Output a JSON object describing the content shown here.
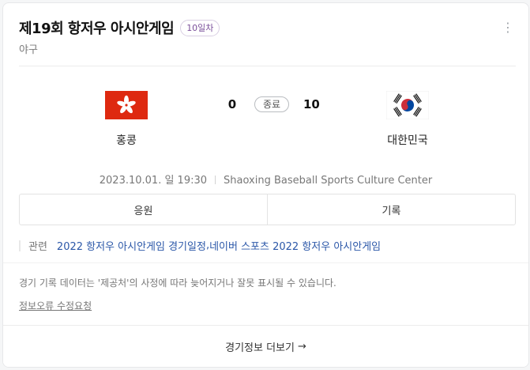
{
  "header": {
    "title": "제19회 항저우 아시안게임",
    "badge": "10일차",
    "subtitle": "야구",
    "more_icon": "⋮"
  },
  "match": {
    "home": {
      "name": "홍콩",
      "score": "0",
      "flag": "hong-kong-flag"
    },
    "away": {
      "name": "대한민국",
      "score": "10",
      "flag": "south-korea-flag"
    },
    "status": "종료",
    "datetime": "2023.10.01. 일 19:30",
    "venue": "Shaoxing Baseball Sports Culture Center"
  },
  "tabs": [
    {
      "label": "응원"
    },
    {
      "label": "기록"
    }
  ],
  "related": {
    "label": "관련",
    "links": [
      "2022 항저우 아시안게임 경기일정",
      "네이버 스포츠 2022 항저우 아시안게임"
    ]
  },
  "notice": "경기 기록 데이터는 '제공처'의 사정에 따라 늦어지거나 잘못 표시될 수 있습니다.",
  "report_link": "정보오류 수정요청",
  "footer": {
    "label": "경기정보 더보기",
    "arrow": "→"
  },
  "colors": {
    "badge_text": "#7a4f9a",
    "link": "#2b57a8",
    "hk_red": "#de2910",
    "kr_red": "#cd2e3a",
    "kr_blue": "#0047a0"
  }
}
